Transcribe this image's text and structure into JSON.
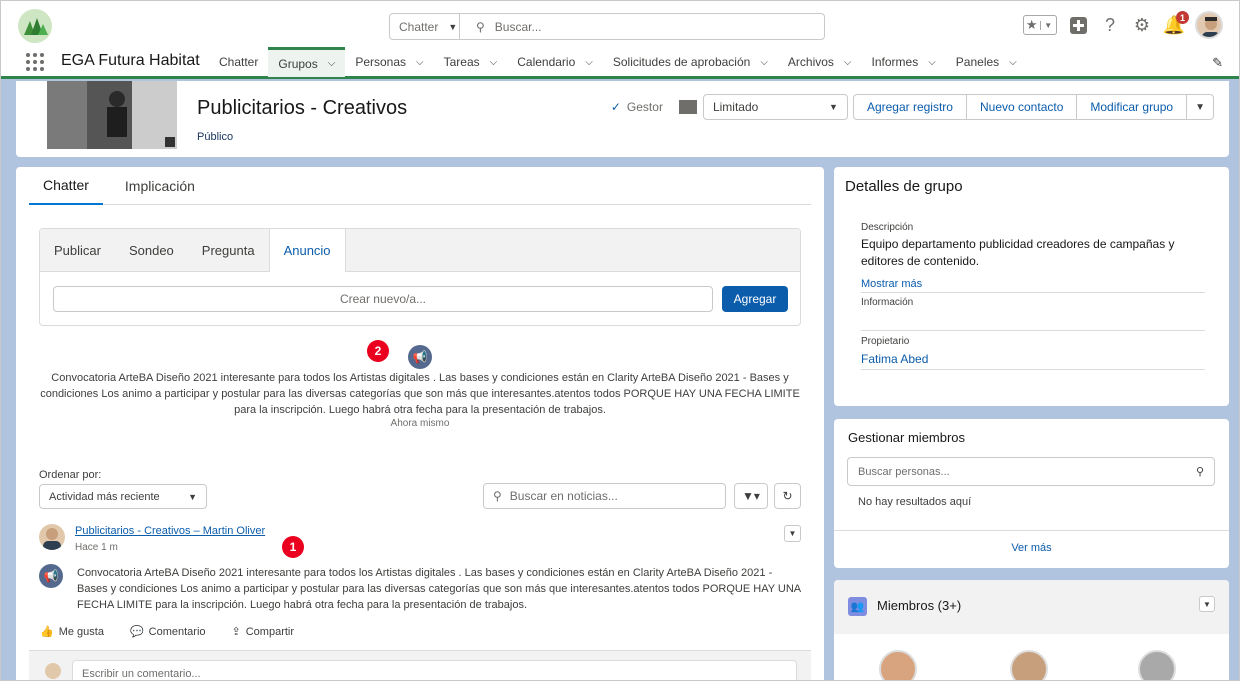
{
  "search": {
    "scope": "Chatter",
    "placeholder": "Buscar..."
  },
  "notifications": {
    "count": "1"
  },
  "app": {
    "name": "EGA Futura Habitat"
  },
  "nav": [
    {
      "label": "Chatter"
    },
    {
      "label": "Grupos"
    },
    {
      "label": "Personas"
    },
    {
      "label": "Tareas"
    },
    {
      "label": "Calendario"
    },
    {
      "label": "Solicitudes de aprobación"
    },
    {
      "label": "Archivos"
    },
    {
      "label": "Informes"
    },
    {
      "label": "Paneles"
    }
  ],
  "group": {
    "title": "Publicitarios - Creativos",
    "visibility": "Público",
    "manager_label": "Gestor",
    "email_setting": "Limitado",
    "buttons": {
      "add_record": "Agregar registro",
      "new_contact": "Nuevo contacto",
      "edit_group": "Modificar grupo"
    }
  },
  "tabs": {
    "chatter": "Chatter",
    "engagement": "Implicación"
  },
  "publisher": {
    "tabs": [
      "Publicar",
      "Sondeo",
      "Pregunta",
      "Anuncio"
    ],
    "placeholder": "Crear nuevo/a...",
    "submit": "Agregar"
  },
  "announcement": {
    "badge": "2",
    "text": "Convocatoria ArteBA Diseño 2021 interesante para todos los Artistas digitales . Las bases y condiciones están en Clarity ArteBA Diseño 2021 - Bases y condiciones Los animo a participar y postular para las diversas categorías que son más que interesantes.atentos todos PORQUE HAY UNA FECHA LIMITE para la inscripción. Luego habrá otra fecha para la presentación de trabajos.",
    "time": "Ahora mismo"
  },
  "feed": {
    "sort_label": "Ordenar por:",
    "sort_value": "Actividad más reciente",
    "search_placeholder": "Buscar en noticias..."
  },
  "post": {
    "title": "Publicitarios - Creativos – Martin Oliver",
    "time": "Hace 1 m",
    "badge": "1",
    "text": "Convocatoria ArteBA Diseño 2021 interesante para todos los Artistas digitales . Las bases y condiciones están en Clarity ArteBA Diseño 2021 - Bases y condiciones Los animo a participar y postular para las diversas categorías que son más que interesantes.atentos todos PORQUE HAY UNA FECHA LIMITE para la inscripción. Luego habrá otra fecha para la presentación de trabajos.",
    "like": "Me gusta",
    "comment": "Comentario",
    "share": "Compartir",
    "comment_placeholder": "Escribir un comentario..."
  },
  "details": {
    "title": "Detalles de grupo",
    "desc_label": "Descripción",
    "desc_value": "Equipo departamento publicidad creadores de campañas y editores de contenido.",
    "show_more": "Mostrar más",
    "info_label": "Información",
    "owner_label": "Propietario",
    "owner_value": "Fatima Abed"
  },
  "manage": {
    "title": "Gestionar miembros",
    "placeholder": "Buscar personas...",
    "no_results": "No hay resultados aquí",
    "see_more": "Ver más"
  },
  "members": {
    "title": "Miembros (3+)"
  }
}
